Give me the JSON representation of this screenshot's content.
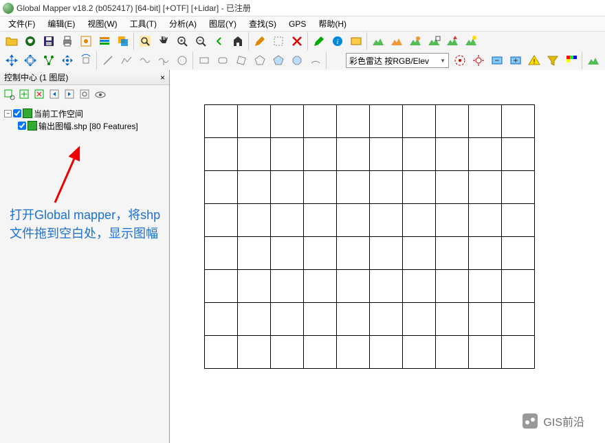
{
  "titlebar": {
    "text": "Global Mapper v18.2 (b052417) [64-bit] [+OTF] [+Lidar] - 已注册"
  },
  "menubar": {
    "items": [
      "文件(F)",
      "编辑(E)",
      "视图(W)",
      "工具(T)",
      "分析(A)",
      "图层(Y)",
      "查找(S)",
      "GPS",
      "帮助(H)"
    ]
  },
  "shader_dropdown": {
    "value": "彩色雷达 按RGB/Elev"
  },
  "control_center": {
    "title": "控制中心 (1 图层)",
    "tree": {
      "root": "当前工作空间",
      "layer": "输出图幅.shp [80 Features]"
    }
  },
  "annotation": {
    "text": "打开Global mapper，将shp文件拖到空白处，显示图幅"
  },
  "watermark": {
    "text": "GIS前沿"
  },
  "grid": {
    "rows": 8,
    "cols": 10
  }
}
